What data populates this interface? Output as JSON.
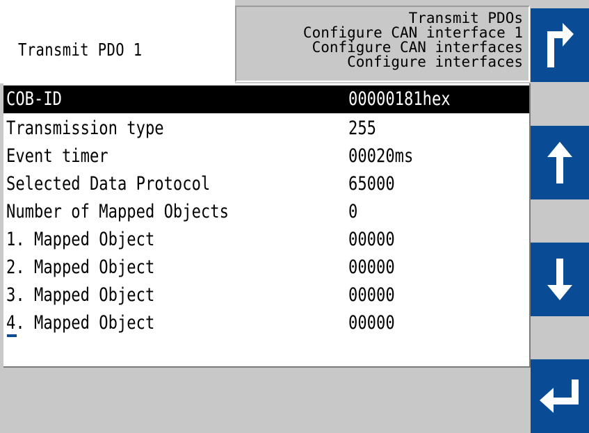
{
  "header": {
    "title": "Transmit PDO 1",
    "breadcrumb": [
      "Transmit PDOs",
      "Configure CAN interface 1",
      "Configure CAN interfaces",
      "Configure interfaces"
    ]
  },
  "buttons": {
    "back_icon": "return-arrow-up-right-icon",
    "up_icon": "arrow-up-icon",
    "down_icon": "arrow-down-icon",
    "enter_icon": "enter-return-arrow-icon",
    "color": "#0a4b96"
  },
  "list": {
    "selected_index": 0,
    "rows": [
      {
        "label": "COB-ID",
        "value": "00000181hex"
      },
      {
        "label": "Transmission type",
        "value": "255"
      },
      {
        "label": "Event timer",
        "value": "00020ms"
      },
      {
        "label": "Selected Data Protocol",
        "value": "65000"
      },
      {
        "label": "Number of Mapped Objects",
        "value": "0"
      },
      {
        "label": "1. Mapped Object",
        "value": "00000"
      },
      {
        "label": "2. Mapped Object",
        "value": "00000"
      },
      {
        "label": "3. Mapped Object",
        "value": "00000"
      },
      {
        "label": "4. Mapped Object",
        "value": "00000"
      }
    ]
  },
  "colors": {
    "background": "#c8c8c8",
    "panel": "#ffffff",
    "selection": "#000000",
    "accent": "#0a4b96"
  }
}
